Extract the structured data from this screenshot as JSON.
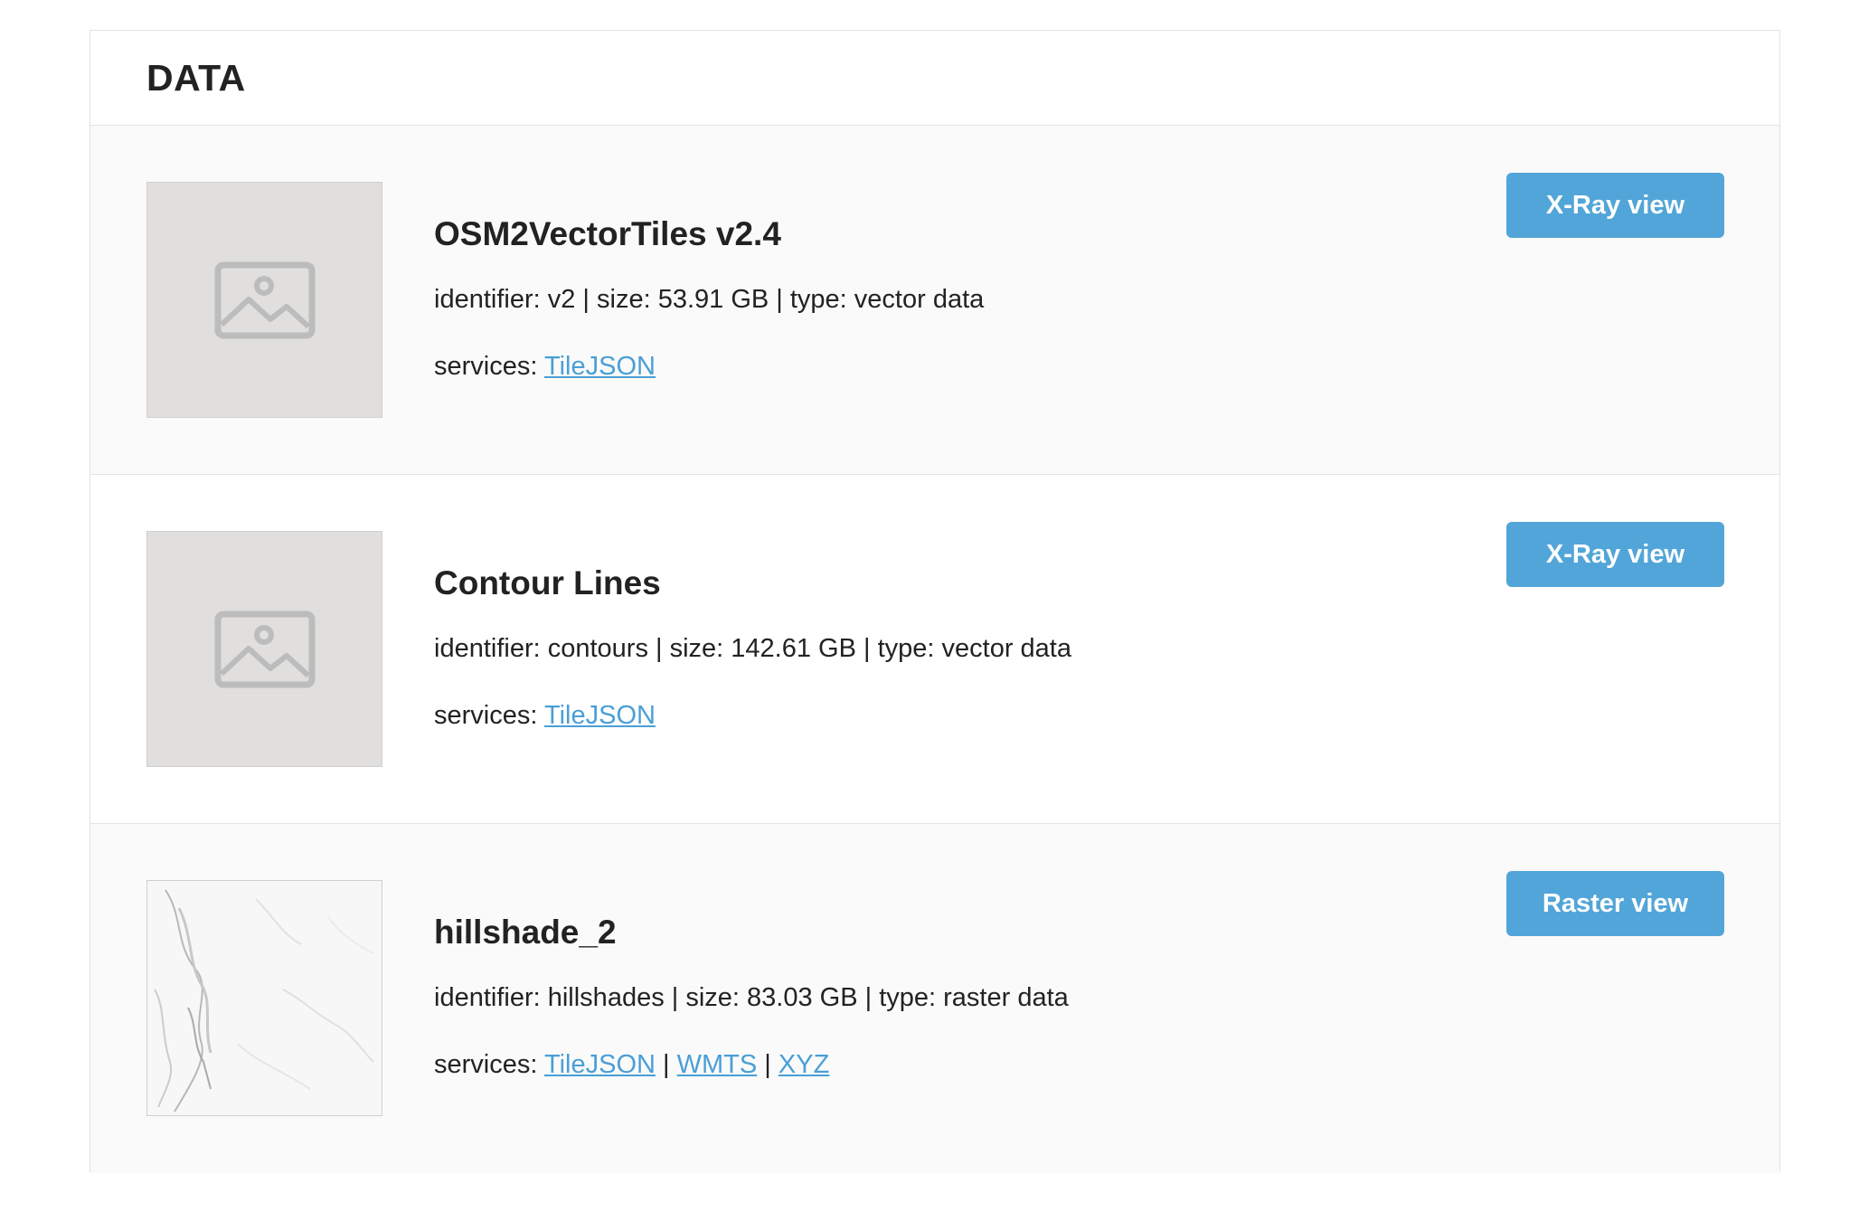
{
  "header": {
    "title": "DATA"
  },
  "items": [
    {
      "name": "OSM2VectorTiles v2.4",
      "meta": "identifier: v2 | size: 53.91 GB | type: vector data",
      "services_label": "services:",
      "services": [
        "TileJSON"
      ],
      "button": "X-Ray view",
      "thumb_icon": "image-placeholder-icon"
    },
    {
      "name": "Contour Lines",
      "meta": "identifier: contours | size: 142.61 GB | type: vector data",
      "services_label": "services:",
      "services": [
        "TileJSON"
      ],
      "button": "X-Ray view",
      "thumb_icon": "image-placeholder-icon"
    },
    {
      "name": "hillshade_2",
      "meta": "identifier: hillshades | size: 83.03 GB | type: raster data",
      "services_label": "services:",
      "services": [
        "TileJSON",
        "WMTS",
        "XYZ"
      ],
      "service_separator": "|",
      "button": "Raster view",
      "thumb_icon": "hillshade-thumbnail"
    }
  ],
  "colors": {
    "button_bg": "#52a5d8",
    "link": "#4a9fd6",
    "row_alt_bg": "#fafafa",
    "placeholder_bg": "#e0dfdd"
  }
}
